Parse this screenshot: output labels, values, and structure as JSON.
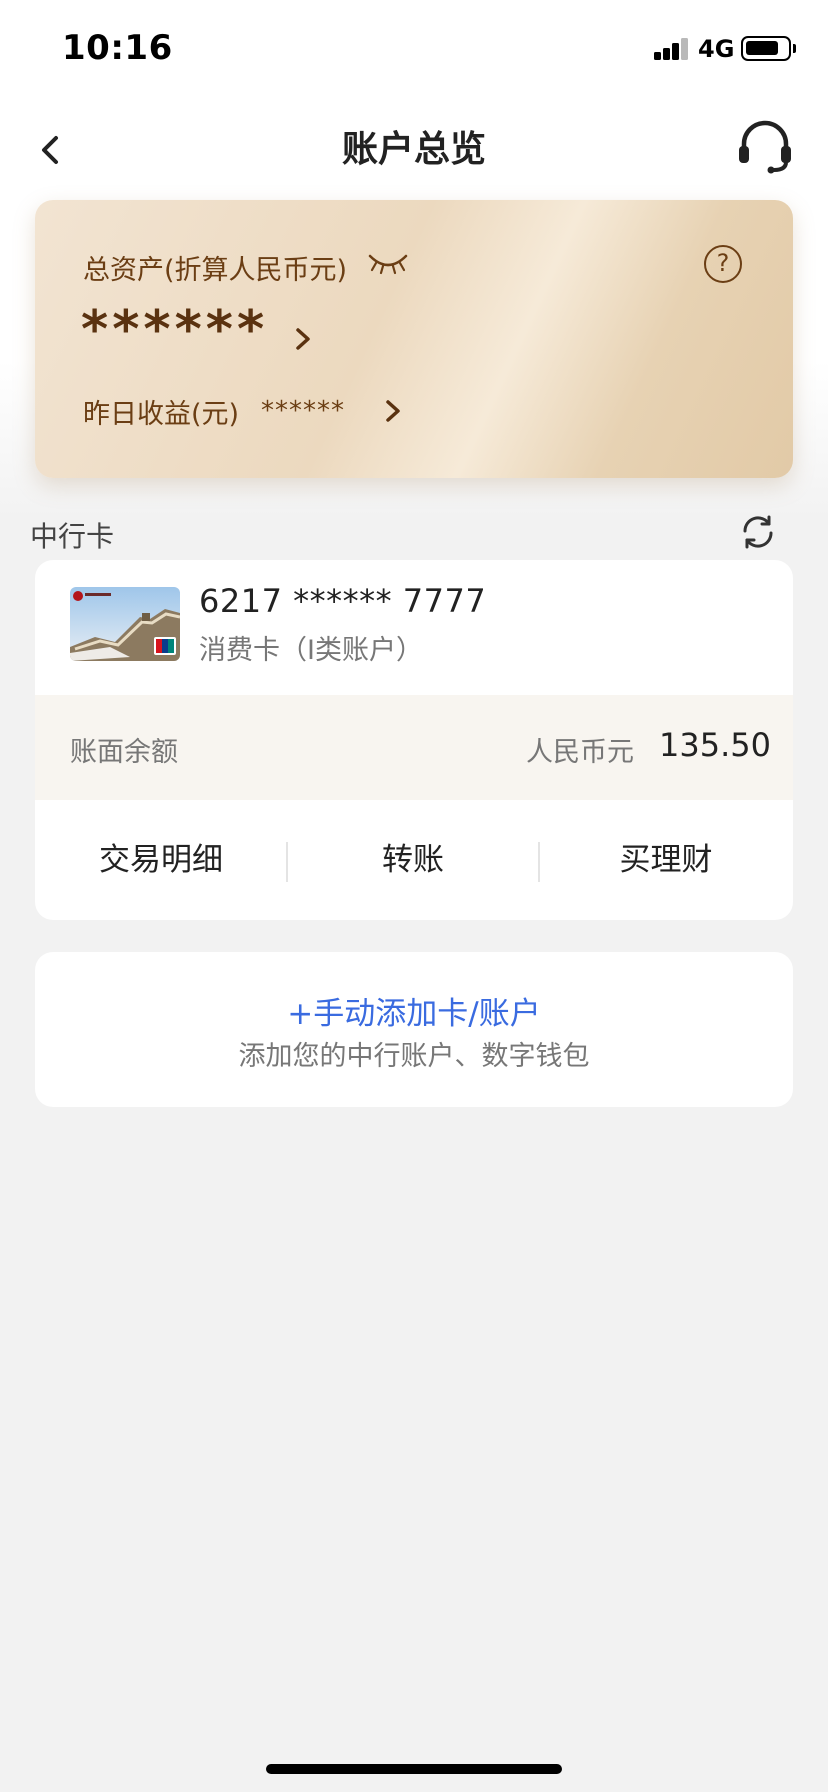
{
  "status_bar": {
    "time": "10:16",
    "network": "4G",
    "battery_level": 0.8
  },
  "navbar": {
    "title": "账户总览",
    "back_icon": "chevron-left-icon",
    "service_icon": "headset-icon"
  },
  "asset_card": {
    "label": "总资产(折算人民币元)",
    "amount_masked": "******",
    "yesterday_label": "昨日收益(元)",
    "yesterday_value_masked": "******",
    "help_glyph": "?",
    "colors": {
      "text": "#6b3e14",
      "amount": "#5a3210"
    }
  },
  "section": {
    "title": "中行卡",
    "refresh_icon": "refresh-icon"
  },
  "card": {
    "number": "6217 ****** 7777",
    "type": "消费卡（I类账户）",
    "balance_label": "账面余额",
    "currency": "人民币元",
    "balance": "135.50",
    "actions": [
      {
        "label": "交易明细"
      },
      {
        "label": "转账"
      },
      {
        "label": "买理财"
      }
    ]
  },
  "add_account": {
    "title": "+手动添加卡/账户",
    "subtitle": "添加您的中行账户、数字钱包",
    "accent_color": "#3a6be0"
  }
}
